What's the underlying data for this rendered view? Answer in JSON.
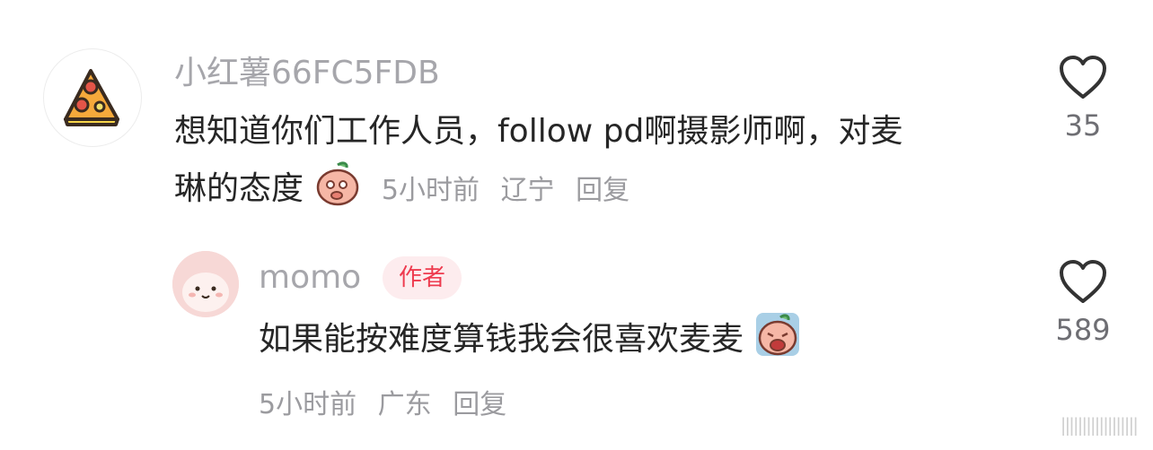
{
  "comments": [
    {
      "username": "小红薯66FC5FDB",
      "text_line1": "想知道你们工作人员，follow pd啊摄影师啊，对麦",
      "text_line2": "琳的态度",
      "time": "5小时前",
      "location": "辽宁",
      "reply_label": "回复",
      "likes": "35",
      "avatar_icon": "pizza-slice-icon",
      "sticker_icon": "shy-peach-sticker-icon"
    },
    {
      "username": "momo",
      "badge": "作者",
      "text_line1": "如果能按难度算钱我会很喜欢麦麦",
      "time": "5小时前",
      "location": "广东",
      "reply_label": "回复",
      "likes": "589",
      "avatar_icon": "pink-blob-avatar-icon",
      "sticker_icon": "crying-peach-sticker-icon"
    }
  ],
  "watermark": "||||||||||||||||||",
  "colors": {
    "username": "#a6a6ab",
    "badge_bg": "#fdecee",
    "badge_text": "#ee3a4e",
    "meta": "#9b9b9f",
    "body": "#262626"
  }
}
